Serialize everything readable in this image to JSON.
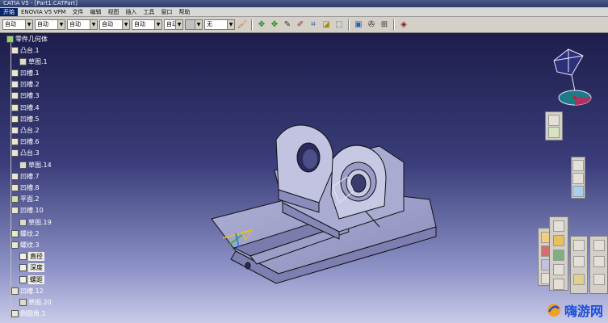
{
  "window": {
    "title": "CATIA V5 - [Part1.CATPart]"
  },
  "menu": [
    "开始",
    "ENOVIA V5 VPM",
    "文件",
    "编辑",
    "视图",
    "插入",
    "工具",
    "窗口",
    "帮助"
  ],
  "toolbar": {
    "combos": [
      "自动",
      "自动",
      "自动",
      "自动",
      "自动",
      "自动",
      "",
      "无"
    ],
    "icons": [
      "paint-icon",
      "move-icon",
      "rotate-icon",
      "pen-icon",
      "measure-icon",
      "frame-icon",
      "plane-icon",
      "view-icon",
      "print-icon"
    ]
  },
  "tree": {
    "root": "零件几何体",
    "items": [
      {
        "label": "凸台.1",
        "type": "boss"
      },
      {
        "label": "草图.1",
        "type": "sketch"
      },
      {
        "label": "凹槽.1",
        "type": "pocket"
      },
      {
        "label": "凹槽.2",
        "type": "pocket"
      },
      {
        "label": "凹槽.3",
        "type": "pocket"
      },
      {
        "label": "凹槽.4",
        "type": "pocket"
      },
      {
        "label": "凹槽.5",
        "type": "pocket"
      },
      {
        "label": "凸台.2",
        "type": "boss"
      },
      {
        "label": "凹槽.6",
        "type": "pocket"
      },
      {
        "label": "凸台.3",
        "type": "boss"
      },
      {
        "label": "草图.14",
        "type": "sketch"
      },
      {
        "label": "凹槽.7",
        "type": "pocket"
      },
      {
        "label": "凹槽.8",
        "type": "pocket"
      },
      {
        "label": "平面.2",
        "type": "plane"
      },
      {
        "label": "凹槽.10",
        "type": "pocket"
      },
      {
        "label": "草图.19",
        "type": "sketch"
      },
      {
        "label": "螺纹.2",
        "type": "thread"
      },
      {
        "label": "螺纹.3",
        "type": "thread"
      },
      {
        "label": "直径",
        "type": "param"
      },
      {
        "label": "深度",
        "type": "param"
      },
      {
        "label": "螺距",
        "type": "param"
      },
      {
        "label": "凹槽.12",
        "type": "pocket"
      },
      {
        "label": "草图.20",
        "type": "sketch"
      },
      {
        "label": "倒圆角.1",
        "type": "fillet"
      }
    ]
  },
  "watermark": {
    "text": "嗨游网"
  },
  "colors": {
    "background_top": "#1d1e4c",
    "background_bottom": "#c9cbe8",
    "part_fill": "#b9bad9",
    "part_edge": "#1a1a2a"
  }
}
